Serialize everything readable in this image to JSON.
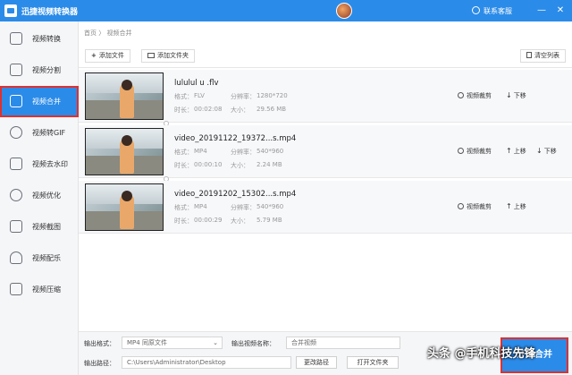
{
  "app": {
    "title": "迅捷视频转换器",
    "support": "联系客服"
  },
  "window": {
    "minimize": "—",
    "close": "✕"
  },
  "sidebar": {
    "items": [
      {
        "label": "视频转换",
        "icon": "video-convert-icon"
      },
      {
        "label": "视频分割",
        "icon": "video-split-icon"
      },
      {
        "label": "视频合并",
        "icon": "video-merge-icon",
        "active": true
      },
      {
        "label": "视频转GIF",
        "icon": "gif-icon"
      },
      {
        "label": "视频去水印",
        "icon": "watermark-remove-icon"
      },
      {
        "label": "视频优化",
        "icon": "optimize-icon"
      },
      {
        "label": "视频截图",
        "icon": "screenshot-icon"
      },
      {
        "label": "视频配乐",
        "icon": "music-icon"
      },
      {
        "label": "视频压缩",
        "icon": "compress-icon"
      }
    ]
  },
  "breadcrumb": "首页 〉 视频合并",
  "toolbar": {
    "add_file": "添加文件",
    "add_folder": "添加文件夹",
    "clear_list": "清空列表"
  },
  "labels": {
    "format": "格式：",
    "resolution": "分辨率：",
    "duration": "时长：",
    "size": "大小："
  },
  "actions": {
    "cut": "视频裁剪",
    "up": "上移",
    "down": "下移"
  },
  "files": [
    {
      "name": "lululul u .flv",
      "format": "FLV",
      "resolution": "1280*720",
      "duration": "00:02:08",
      "size": "29.56 MB"
    },
    {
      "name": "video_20191122_19372...s.mp4",
      "format": "MP4",
      "resolution": "540*960",
      "duration": "00:00:10",
      "size": "2.24 MB"
    },
    {
      "name": "video_20191202_15302...s.mp4",
      "format": "MP4",
      "resolution": "540*960",
      "duration": "00:00:29",
      "size": "5.79 MB"
    }
  ],
  "bottom": {
    "output_format_label": "输出格式：",
    "output_format_value": "MP4  同原文件",
    "output_name_label": "输出视频名称：",
    "output_name_value": "合并视频",
    "output_path_label": "输出路径：",
    "output_path_value": "C:\\Users\\Administrator\\Desktop",
    "change_path": "更改路径",
    "open_folder": "打开文件夹",
    "start": "开始合并"
  },
  "watermark": "头条 @手机科技先锋",
  "colors": {
    "accent": "#2b8be8",
    "highlight": "#e0302f"
  }
}
